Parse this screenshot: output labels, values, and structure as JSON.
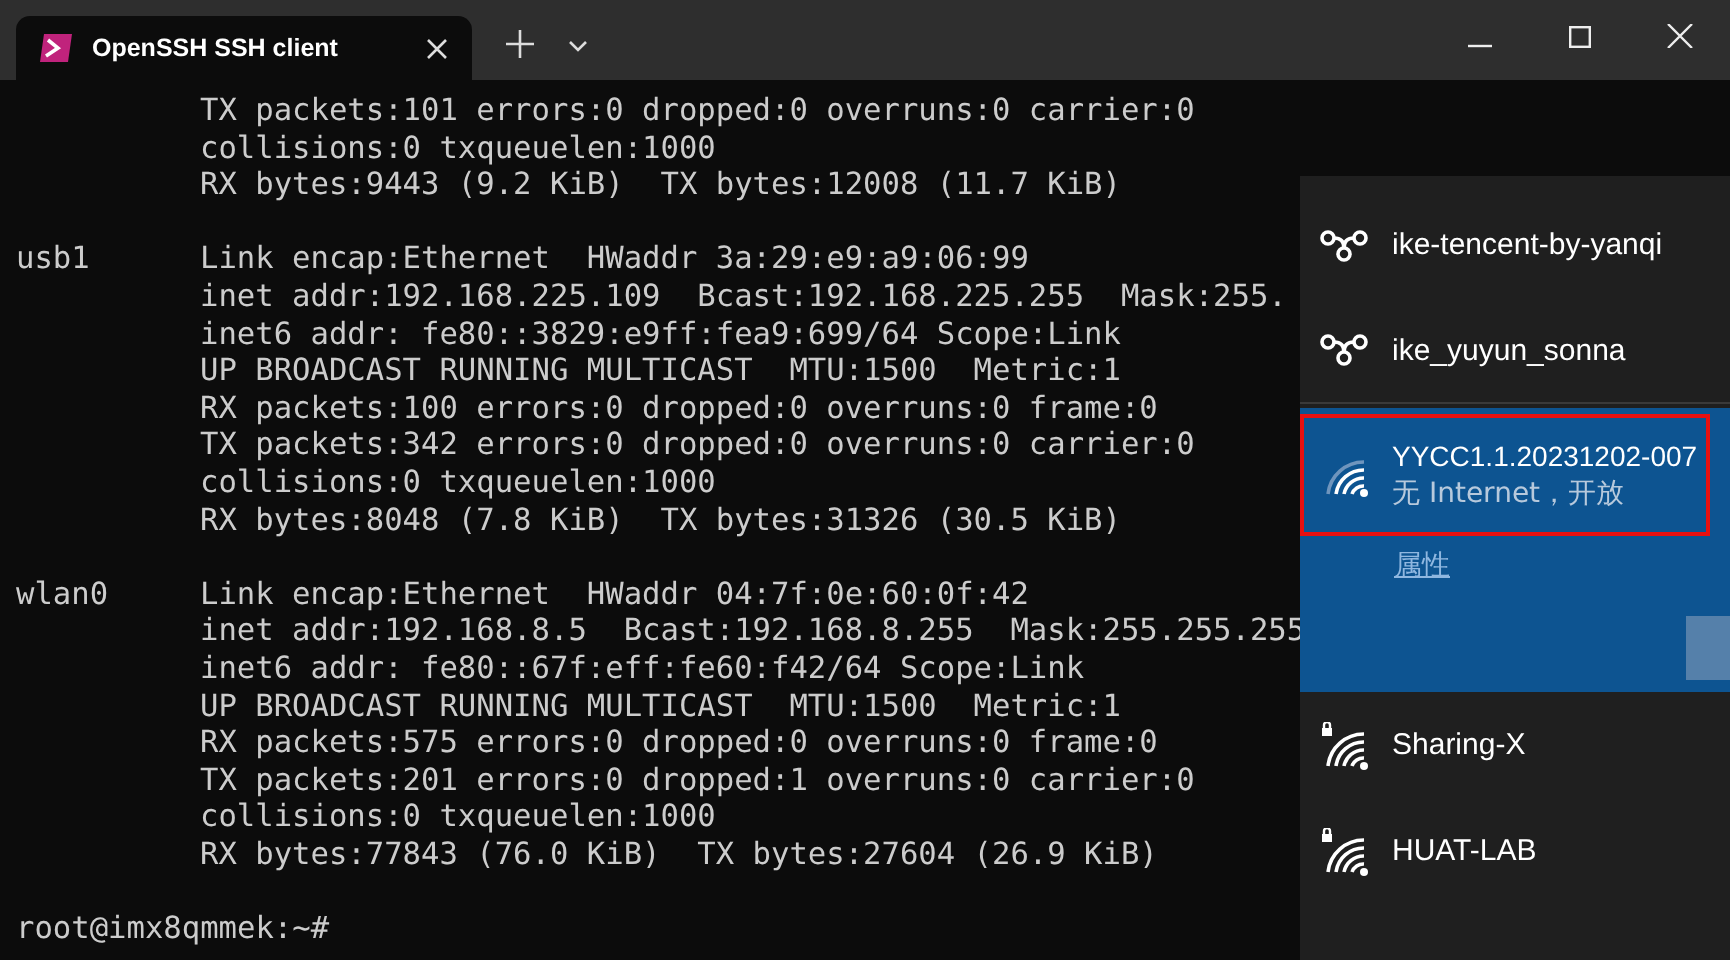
{
  "window": {
    "tab_title": "OpenSSH SSH client"
  },
  "terminal": {
    "blocks": [
      {
        "lines": [
          "TX packets:101 errors:0 dropped:0 overruns:0 carrier:0",
          "collisions:0 txqueuelen:1000",
          "RX bytes:9443 (9.2 KiB)  TX bytes:12008 (11.7 KiB)"
        ]
      },
      {
        "label": "usb1",
        "lines": [
          "Link encap:Ethernet  HWaddr 3a:29:e9:a9:06:99",
          "inet addr:192.168.225.109  Bcast:192.168.225.255  Mask:255.",
          "inet6 addr: fe80::3829:e9ff:fea9:699/64 Scope:Link",
          "UP BROADCAST RUNNING MULTICAST  MTU:1500  Metric:1",
          "RX packets:100 errors:0 dropped:0 overruns:0 frame:0",
          "TX packets:342 errors:0 dropped:0 overruns:0 carrier:0",
          "collisions:0 txqueuelen:1000",
          "RX bytes:8048 (7.8 KiB)  TX bytes:31326 (30.5 KiB)"
        ]
      },
      {
        "label": "wlan0",
        "lines": [
          "Link encap:Ethernet  HWaddr 04:7f:0e:60:0f:42",
          "inet addr:192.168.8.5  Bcast:192.168.8.255  Mask:255.255.255",
          "inet6 addr: fe80::67f:eff:fe60:f42/64 Scope:Link",
          "UP BROADCAST RUNNING MULTICAST  MTU:1500  Metric:1",
          "RX packets:575 errors:0 dropped:0 overruns:0 frame:0",
          "TX packets:201 errors:0 dropped:1 overruns:0 carrier:0",
          "collisions:0 txqueuelen:1000",
          "RX bytes:77843 (76.0 KiB)  TX bytes:27604 (26.9 KiB)"
        ]
      }
    ],
    "prompt": "root@imx8qmmek:~#"
  },
  "network_panel": {
    "networks": [
      {
        "kind": "hotspot",
        "name": "ike-tencent-by-yanqi",
        "selected": false
      },
      {
        "kind": "hotspot",
        "name": "ike_yuyun_sonna",
        "selected": false
      },
      {
        "kind": "wifi_open",
        "name": "YYCC1.1.20231202-007",
        "status": "无 Internet，开放",
        "link": "属性",
        "selected": true
      },
      {
        "kind": "wifi_secured",
        "name": "Sharing-X",
        "selected": false
      },
      {
        "kind": "wifi_secured",
        "name": "HUAT-LAB",
        "selected": false
      }
    ]
  }
}
